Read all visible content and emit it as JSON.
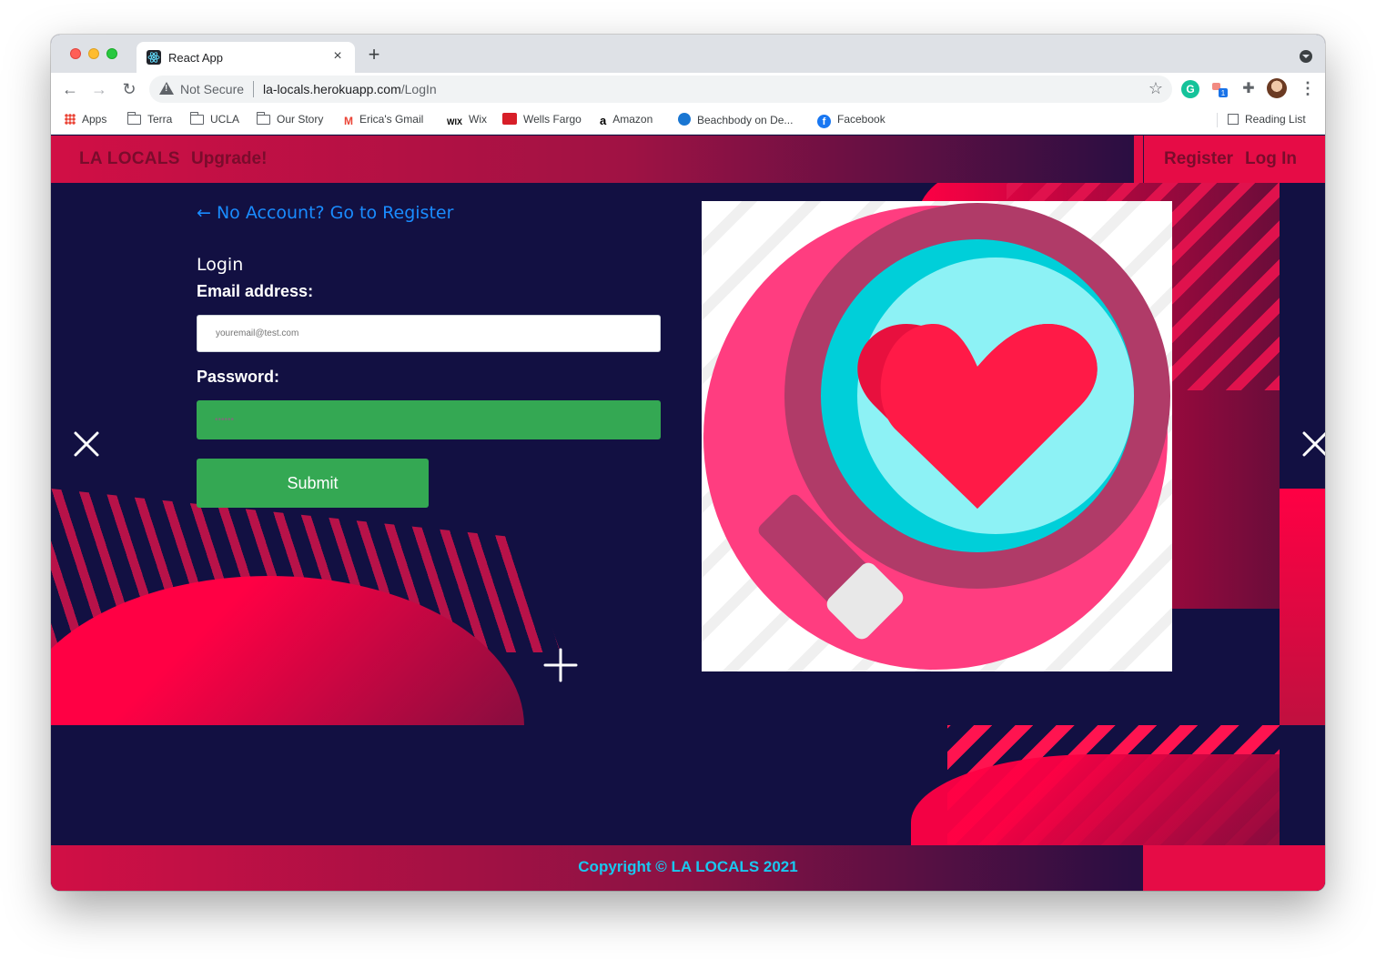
{
  "browser": {
    "tab_title": "React App",
    "tab_close": "×",
    "new_tab": "+",
    "security_label": "Not Secure",
    "url_host": "la-locals.herokuapp.com",
    "url_path": "/LogIn",
    "bookmarks": [
      {
        "label": "Apps",
        "icon": "apps-grid-icon"
      },
      {
        "label": "Terra",
        "icon": "folder-icon"
      },
      {
        "label": "UCLA",
        "icon": "folder-icon"
      },
      {
        "label": "Our Story",
        "icon": "folder-icon"
      },
      {
        "label": "Erica's Gmail",
        "icon": "gmail-icon"
      },
      {
        "label": "Wix",
        "icon": "wix-icon"
      },
      {
        "label": "Wells Fargo",
        "icon": "wells-fargo-icon"
      },
      {
        "label": "Amazon",
        "icon": "amazon-icon"
      },
      {
        "label": "Beachbody on De...",
        "icon": "beachbody-icon"
      },
      {
        "label": "Facebook",
        "icon": "facebook-icon"
      }
    ],
    "reading_list": "Reading List",
    "extension_badge": "1"
  },
  "header": {
    "brand": "LA LOCALS",
    "upgrade": "Upgrade!",
    "register": "Register",
    "login": "Log In"
  },
  "form": {
    "back_link": "← No Account? Go to Register",
    "title": "Login",
    "email_label": "Email address:",
    "email_placeholder": "youremail@test.com",
    "password_label": "Password:",
    "password_placeholder": "••••••",
    "submit": "Submit"
  },
  "footer": {
    "copyright": "Copyright © LA LOCALS 2021"
  },
  "colors": {
    "page_bg": "#121042",
    "accent_red": "#e60c46",
    "button_green": "#34a853",
    "link_blue": "#1a8cff",
    "footer_text": "#19c8f0"
  }
}
